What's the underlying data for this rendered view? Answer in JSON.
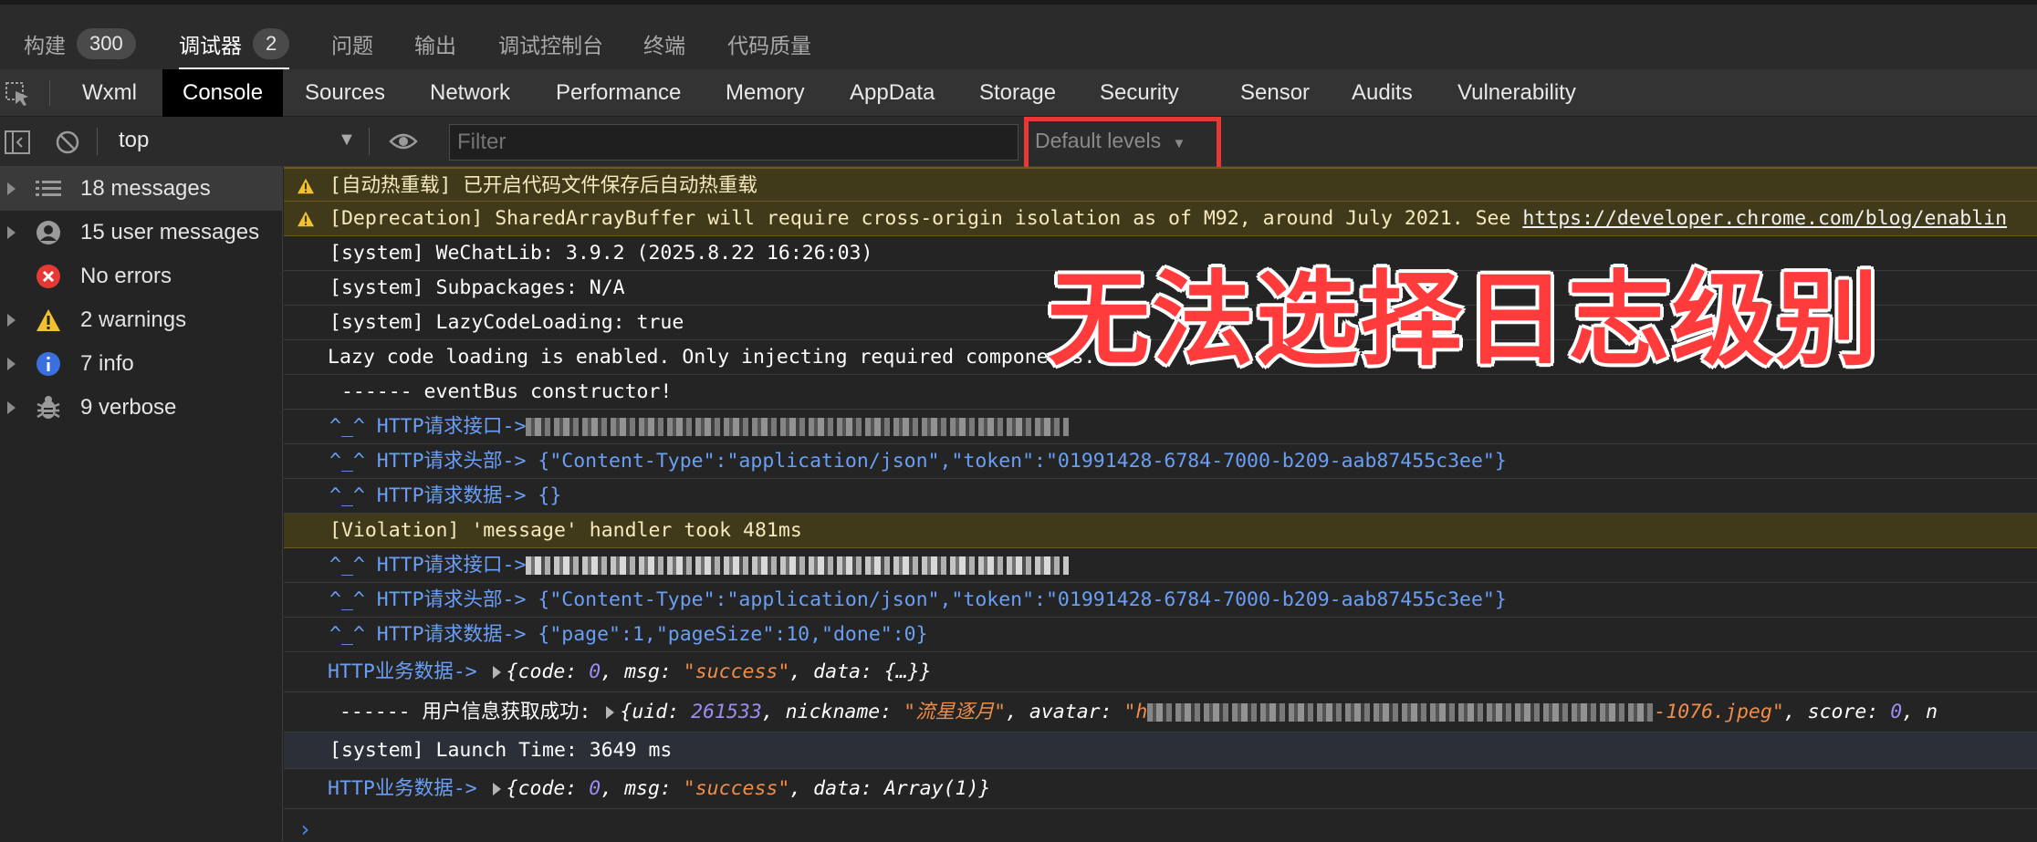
{
  "panel_tabs": [
    {
      "label": "构建",
      "badge": "300"
    },
    {
      "label": "调试器",
      "badge": "2"
    },
    {
      "label": "问题"
    },
    {
      "label": "输出"
    },
    {
      "label": "调试控制台"
    },
    {
      "label": "终端"
    },
    {
      "label": "代码质量"
    }
  ],
  "devtools_tabs": [
    "Wxml",
    "Console",
    "Sources",
    "Network",
    "Performance",
    "Memory",
    "AppData",
    "Storage",
    "Security",
    "Sensor",
    "Audits",
    "Vulnerability"
  ],
  "toolbar": {
    "context": "top",
    "filter_placeholder": "Filter",
    "levels": "Default levels"
  },
  "sidebar": [
    {
      "label": "18 messages",
      "icon": "list-icon"
    },
    {
      "label": "15 user messages",
      "icon": "user-icon"
    },
    {
      "label": "No errors",
      "icon": "error-icon"
    },
    {
      "label": "2 warnings",
      "icon": "warning-icon"
    },
    {
      "label": "7 info",
      "icon": "info-icon"
    },
    {
      "label": "9 verbose",
      "icon": "bug-icon"
    }
  ],
  "messages": {
    "m1": "[自动热重载] 已开启代码文件保存后自动热重载",
    "m2_text": "[Deprecation] SharedArrayBuffer will require cross-origin isolation as of M92, around July 2021. See ",
    "m2_link": "https://developer.chrome.com/blog/enablin",
    "m3": "[system] WeChatLib: 3.9.2 (2025.8.22 16:26:03)",
    "m4": "[system] Subpackages: N/A",
    "m5": "[system] LazyCodeLoading: true",
    "m6": "Lazy code loading is enabled. Only injecting required components.",
    "m7": " ------ eventBus constructor!",
    "m8": "^_^ HTTP请求接口->",
    "m9": "^_^ HTTP请求头部-> {\"Content-Type\":\"application/json\",\"token\":\"01991428-6784-7000-b209-aab87455c3ee\"}",
    "m10": "^_^ HTTP请求数据-> {}",
    "m11": "[Violation] 'message' handler took 481ms",
    "m12": "^_^ HTTP请求接口->",
    "m13": "^_^ HTTP请求头部-> {\"Content-Type\":\"application/json\",\"token\":\"01991428-6784-7000-b209-aab87455c3ee\"}",
    "m14": "^_^ HTTP请求数据-> {\"page\":1,\"pageSize\":10,\"done\":0}",
    "m15_prefix": "HTTP业务数据->",
    "m15_a": "{code: ",
    "m15_b": "0",
    "m15_c": ", msg: ",
    "m15_d": "\"success\"",
    "m15_e": ", data: {…}}",
    "m16_prefix": " ------ 用户信息获取成功: ",
    "m16_a": "{uid: ",
    "m16_b": "261533",
    "m16_c": ", nickname: ",
    "m16_d": "\"流星逐月\"",
    "m16_e": ", avatar: ",
    "m16_f": "\"h",
    "m16_g": "-1076.jpeg\"",
    "m16_h": ", score: ",
    "m16_i": "0",
    "m16_j": ", n",
    "m17": "[system] Launch Time: 3649 ms",
    "m18_prefix": "HTTP业务数据->",
    "m18_a": "{code: ",
    "m18_b": "0",
    "m18_c": ", msg: ",
    "m18_d": "\"success\"",
    "m18_e": ", data: Array(1)}"
  },
  "overlay_text": "无法选择日志级别",
  "colors": {
    "accent_red": "#e53935",
    "link_blue": "#6a9ff5",
    "warning_bg": "#413a1a"
  }
}
